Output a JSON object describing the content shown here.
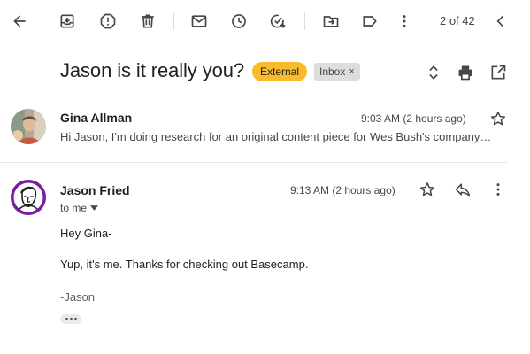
{
  "toolbar": {
    "icons": [
      "back-arrow-icon",
      "archive-icon",
      "report-spam-icon",
      "delete-icon",
      "mark-unread-icon",
      "snooze-icon",
      "add-to-tasks-icon",
      "move-to-icon",
      "label-icon",
      "more-vert-icon",
      "previous-chevron-icon"
    ],
    "pager": "2 of 42"
  },
  "thread": {
    "subject": "Jason is it really you?",
    "badge_external": "External",
    "badge_inbox": "Inbox",
    "badge_inbox_remove": "×"
  },
  "messages": [
    {
      "sender": "Gina Allman",
      "time": "9:03 AM (2 hours ago)",
      "snippet": "Hi Jason, I'm doing research for an original content piece for Wes Bush's company…"
    },
    {
      "sender": "Jason Fried",
      "time": "9:13 AM (2 hours ago)",
      "to": "to me",
      "body": [
        "Hey Gina-",
        "Yup, it's me. Thanks for checking out Basecamp."
      ],
      "signature": "-Jason"
    }
  ],
  "colors": {
    "external_badge": "#f9ba2c",
    "inbox_badge": "#dddddd",
    "icon": "#444746",
    "text": "#1f1f1f",
    "jason_avatar_ring": "#7b1fa2"
  }
}
